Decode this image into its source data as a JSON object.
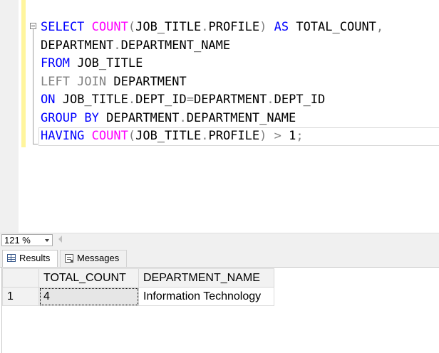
{
  "editor": {
    "lines": [
      [
        {
          "t": "SELECT ",
          "c": "kw"
        },
        {
          "t": "COUNT",
          "c": "fn"
        },
        {
          "t": "(",
          "c": "op"
        },
        {
          "t": "JOB_TITLE",
          "c": ""
        },
        {
          "t": ".",
          "c": "op"
        },
        {
          "t": "PROFILE",
          "c": ""
        },
        {
          "t": ") ",
          "c": "op"
        },
        {
          "t": "AS ",
          "c": "kw"
        },
        {
          "t": "TOTAL_COUNT",
          "c": ""
        },
        {
          "t": ",",
          "c": "op"
        }
      ],
      [
        {
          "t": "DEPARTMENT",
          "c": ""
        },
        {
          "t": ".",
          "c": "op"
        },
        {
          "t": "DEPARTMENT_NAME",
          "c": ""
        }
      ],
      [
        {
          "t": "FROM ",
          "c": "kw"
        },
        {
          "t": "JOB_TITLE",
          "c": ""
        }
      ],
      [
        {
          "t": "LEFT JOIN ",
          "c": "op"
        },
        {
          "t": "DEPARTMENT",
          "c": ""
        }
      ],
      [
        {
          "t": "ON ",
          "c": "kw"
        },
        {
          "t": "JOB_TITLE",
          "c": ""
        },
        {
          "t": ".",
          "c": "op"
        },
        {
          "t": "DEPT_ID",
          "c": ""
        },
        {
          "t": "=",
          "c": "op"
        },
        {
          "t": "DEPARTMENT",
          "c": ""
        },
        {
          "t": ".",
          "c": "op"
        },
        {
          "t": "DEPT_ID",
          "c": ""
        }
      ],
      [
        {
          "t": "GROUP BY ",
          "c": "kw"
        },
        {
          "t": "DEPARTMENT",
          "c": ""
        },
        {
          "t": ".",
          "c": "op"
        },
        {
          "t": "DEPARTMENT_NAME",
          "c": ""
        }
      ],
      [
        {
          "t": "HAVING ",
          "c": "kw"
        },
        {
          "t": "COUNT",
          "c": "fn"
        },
        {
          "t": "(",
          "c": "op"
        },
        {
          "t": "JOB_TITLE",
          "c": ""
        },
        {
          "t": ".",
          "c": "op"
        },
        {
          "t": "PROFILE",
          "c": ""
        },
        {
          "t": ") > ",
          "c": "op"
        },
        {
          "t": "1",
          "c": ""
        },
        {
          "t": ";",
          "c": "op"
        }
      ]
    ]
  },
  "zoom": {
    "value": "121 %"
  },
  "tabs": {
    "results_label": "Results",
    "messages_label": "Messages"
  },
  "results": {
    "columns": [
      "TOTAL_COUNT",
      "DEPARTMENT_NAME"
    ],
    "rows": [
      {
        "num": "1",
        "cells": [
          "4",
          "Information Technology"
        ]
      }
    ]
  },
  "colors": {
    "keyword": "#0000ff",
    "function": "#ff00ff",
    "operator": "#808080",
    "change_bar": "#fff59d"
  },
  "icons": [
    "collapse-minus-icon",
    "chevron-down-icon",
    "scroll-left-arrow-icon",
    "results-grid-icon",
    "messages-icon"
  ]
}
